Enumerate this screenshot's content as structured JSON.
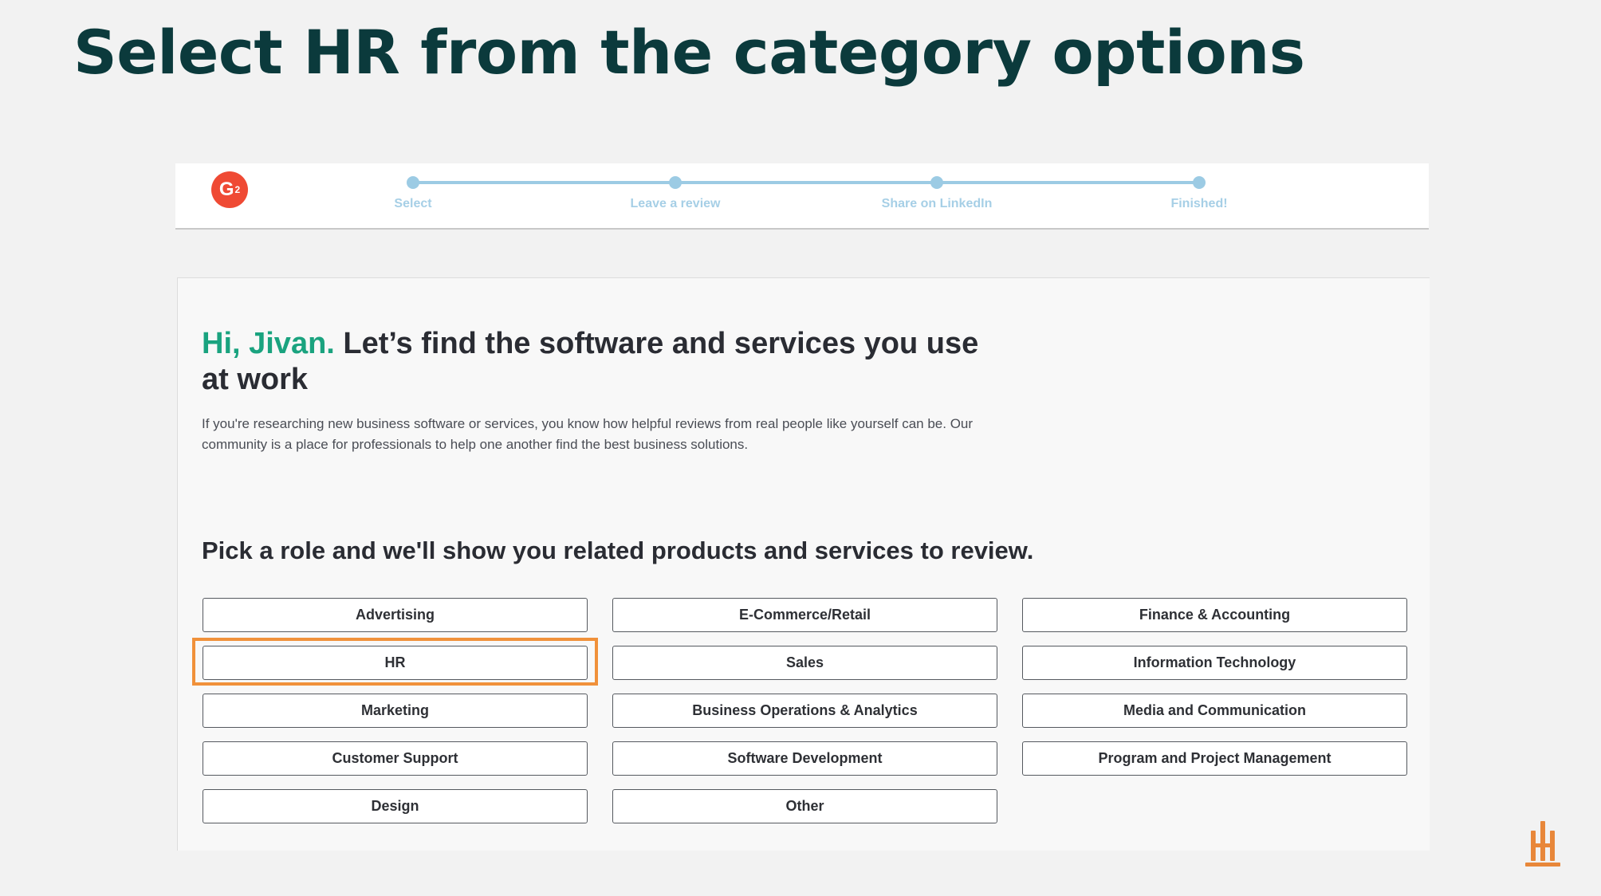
{
  "slide": {
    "title": "Select HR from the category options"
  },
  "header": {
    "logo_text": "G",
    "logo_sup": "2",
    "steps": [
      "Select",
      "Leave a review",
      "Share on LinkedIn",
      "Finished!"
    ]
  },
  "main": {
    "greeting_name": "Hi, Jivan.",
    "greeting_text": " Let’s find the software and services you use at work",
    "intro": "If you're researching new business software or services, you know how helpful reviews from real people like yourself can be. Our community is a place for professionals to help one another find the best business solutions.",
    "pick_heading": "Pick a role and we'll show you related products and services to review.",
    "roles": [
      "Advertising",
      "E-Commerce/Retail",
      "Finance & Accounting",
      "HR",
      "Sales",
      "Information Technology",
      "Marketing",
      "Business Operations & Analytics",
      "Media and Communication",
      "Customer Support",
      "Software Development",
      "Program and Project Management",
      "Design",
      "Other"
    ],
    "highlighted_role": "HR"
  },
  "colors": {
    "title": "#0b3a3c",
    "greeting_accent": "#1aa37f",
    "stepper": "#9ccbe4",
    "logo": "#ef4a34",
    "highlight": "#f0913a",
    "brand_mark": "#e8873a"
  },
  "icons": {
    "logo": "g2-logo-icon",
    "brand_mark": "brand-mark-icon"
  }
}
